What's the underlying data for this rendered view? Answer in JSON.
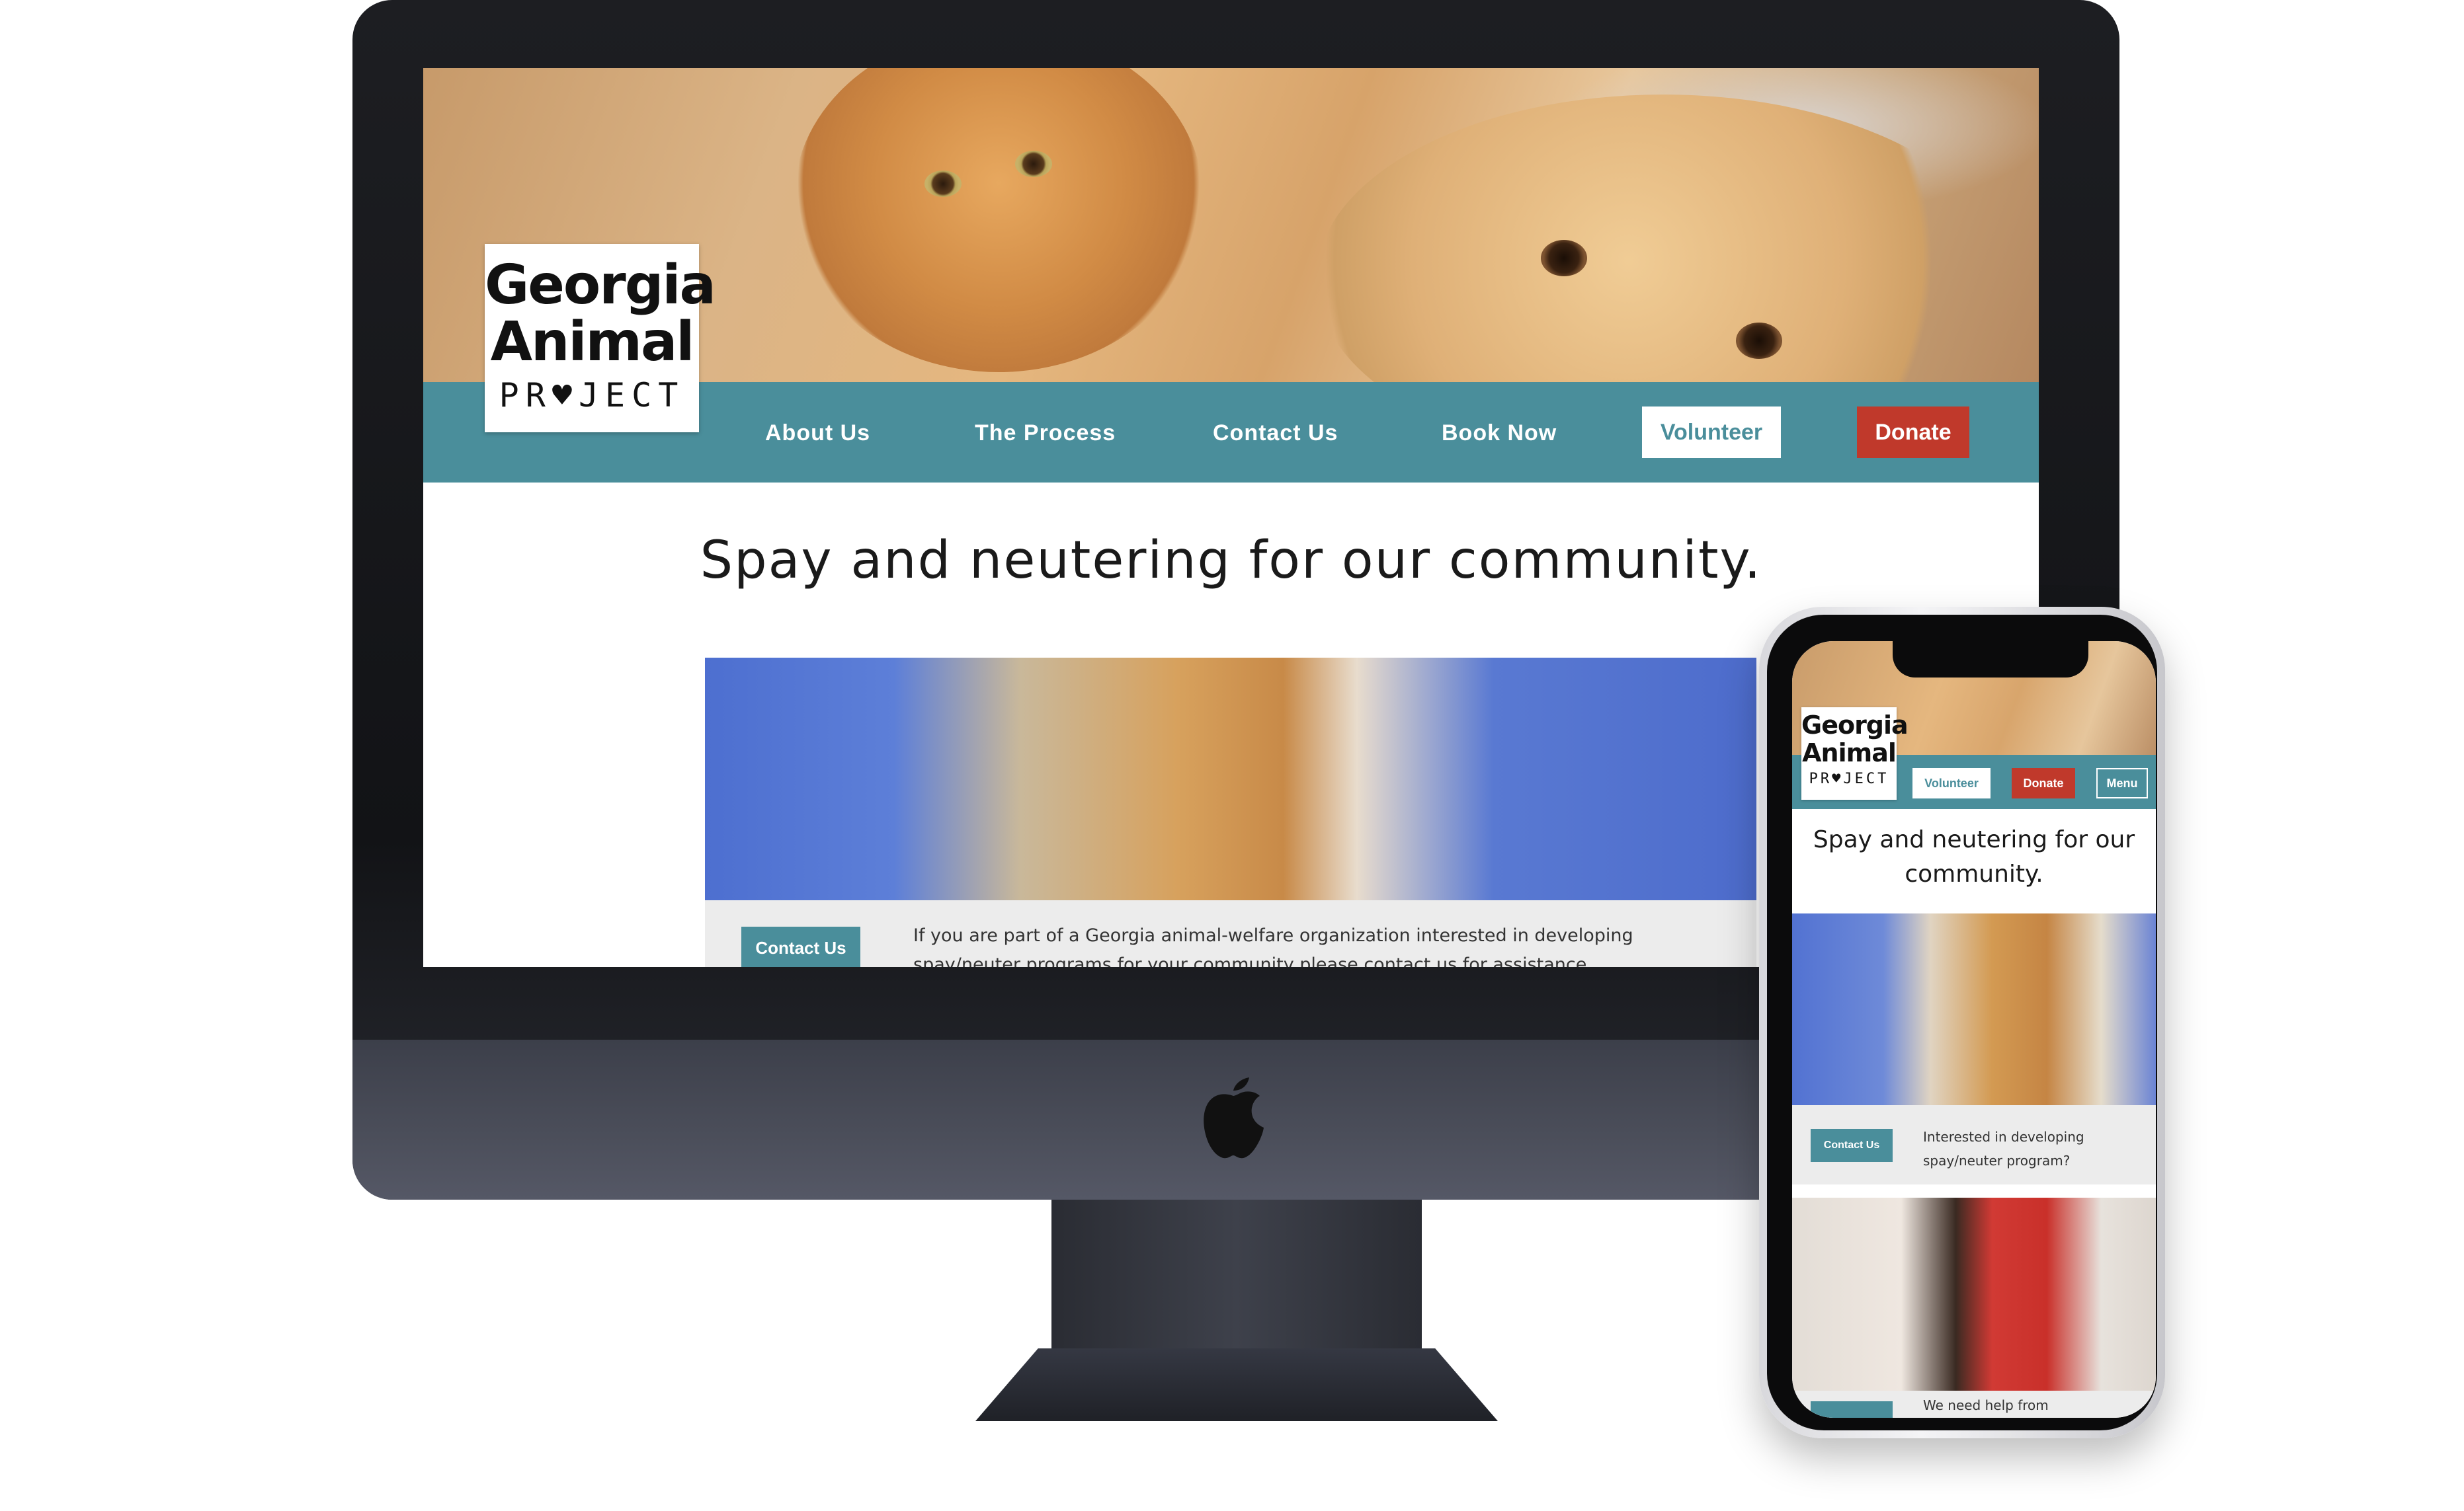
{
  "desktop": {
    "logo": {
      "line1": "Georgia",
      "line2": "Animal",
      "line3": "PR♥JECT"
    },
    "nav": {
      "about": "About Us",
      "process": "The Process",
      "contact": "Contact Us",
      "book": "Book Now",
      "volunteer": "Volunteer",
      "donate": "Donate"
    },
    "headline": "Spay and neutering for our community.",
    "band": {
      "button": "Contact Us",
      "text": "If you are part of a Georgia animal-welfare organization interested in developing spay/neuter programs for your community please contact us for assistance."
    }
  },
  "mobile": {
    "logo": {
      "line1": "Georgia",
      "line2": "Animal",
      "line3": "PR♥JECT"
    },
    "nav": {
      "volunteer": "Volunteer",
      "donate": "Donate",
      "menu": "Menu"
    },
    "headline": "Spay and neutering for our community.",
    "band1": {
      "button": "Contact Us",
      "text": "Interested in developing spay/neuter program?"
    },
    "band2": {
      "text": "We need help from"
    }
  },
  "colors": {
    "teal": "#4a8e9b",
    "red": "#c0392b"
  }
}
